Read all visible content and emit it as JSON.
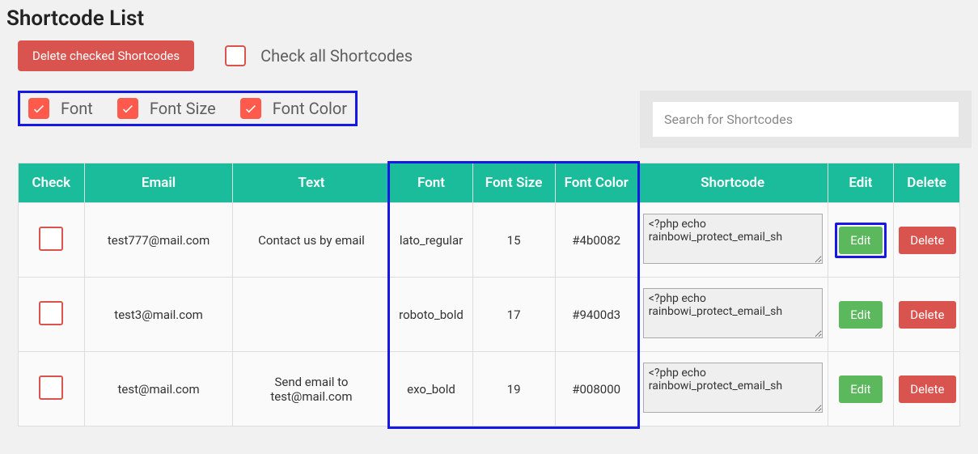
{
  "page_title": "Shortcode List",
  "top": {
    "delete_checked_label": "Delete checked Shortcodes",
    "check_all_label": "Check all Shortcodes"
  },
  "filters": {
    "font_label": "Font",
    "font_size_label": "Font Size",
    "font_color_label": "Font Color",
    "font_checked": true,
    "font_size_checked": true,
    "font_color_checked": true
  },
  "search": {
    "placeholder": "Search for Shortcodes",
    "value": ""
  },
  "table": {
    "headers": {
      "check": "Check",
      "email": "Email",
      "text": "Text",
      "font": "Font",
      "font_size": "Font Size",
      "font_color": "Font Color",
      "shortcode": "Shortcode",
      "edit": "Edit",
      "delete": "Delete"
    },
    "rows": [
      {
        "checked": false,
        "email": "test777@mail.com",
        "text": "Contact us by email",
        "font": "lato_regular",
        "font_size": "15",
        "font_color": "#4b0082",
        "shortcode": "<?php echo rainbowi_protect_email_sh",
        "highlight_edit": true
      },
      {
        "checked": false,
        "email": "test3@mail.com",
        "text": "",
        "font": "roboto_bold",
        "font_size": "17",
        "font_color": "#9400d3",
        "shortcode": "<?php echo rainbowi_protect_email_sh",
        "highlight_edit": false
      },
      {
        "checked": false,
        "email": "test@mail.com",
        "text": "Send email to test@mail.com",
        "font": "exo_bold",
        "font_size": "19",
        "font_color": "#008000",
        "shortcode": "<?php echo rainbowi_protect_email_sh",
        "highlight_edit": false
      }
    ],
    "edit_label": "Edit",
    "delete_label": "Delete"
  },
  "colors": {
    "teal": "#1abc9c",
    "red": "#d9534f",
    "orange_red": "#ff5a4c",
    "green": "#5cb85c",
    "blue_outline": "#1818e6"
  }
}
